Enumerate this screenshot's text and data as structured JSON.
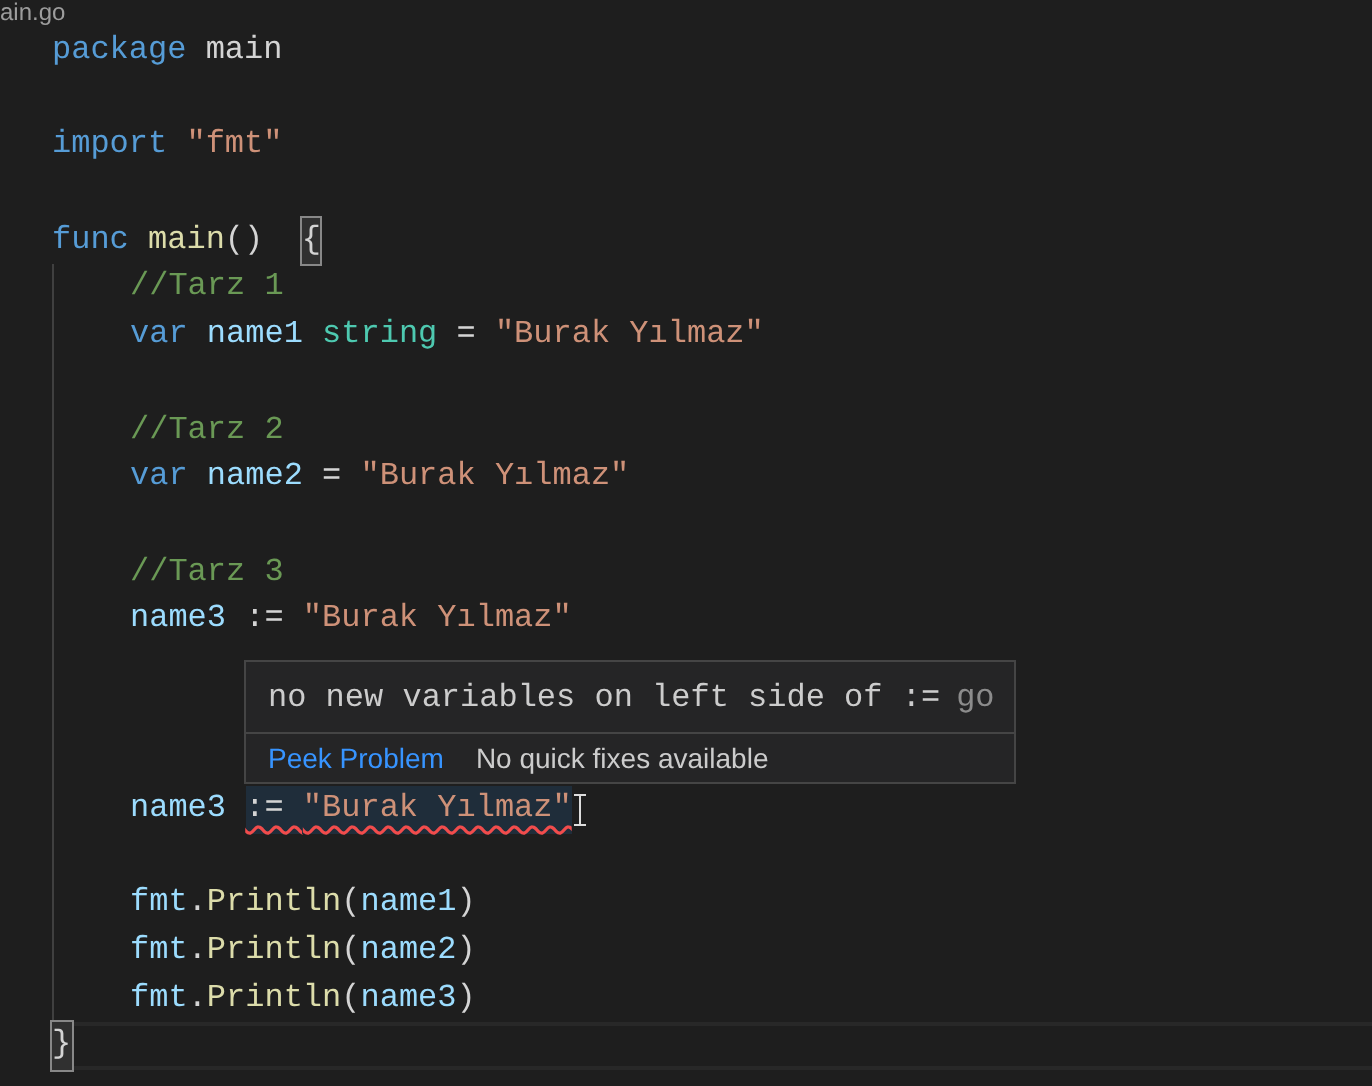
{
  "tab": {
    "title": "ain.go"
  },
  "lines": [
    {
      "kind": "code",
      "tokens": [
        {
          "kind": "keyword",
          "text": "package"
        },
        {
          "kind": "plain",
          "text": " main"
        }
      ]
    },
    {
      "kind": "blank"
    },
    {
      "kind": "code",
      "tokens": [
        {
          "kind": "keyword",
          "text": "import"
        },
        {
          "kind": "string",
          "text": " \"fmt\""
        }
      ]
    },
    {
      "kind": "blank"
    },
    {
      "kind": "code",
      "tokens": [
        {
          "kind": "keyword",
          "text": "func"
        },
        {
          "kind": "function",
          "text": " main"
        },
        {
          "kind": "plain",
          "text": "()  "
        },
        {
          "kind": "bracket",
          "text": "{",
          "matched": true
        }
      ],
      "children": [
        {
          "kind": "code",
          "tokens": [
            {
              "kind": "comment",
              "text": "//Tarz 1"
            }
          ]
        },
        {
          "kind": "code",
          "tokens": [
            {
              "kind": "keyword",
              "text": "var"
            },
            {
              "kind": "variable",
              "text": " name1 "
            },
            {
              "kind": "type",
              "text": "string"
            },
            {
              "kind": "plain",
              "text": " = "
            },
            {
              "kind": "string",
              "text": "\"Burak Yılmaz\""
            }
          ]
        },
        {
          "kind": "blank"
        },
        {
          "kind": "code",
          "tokens": [
            {
              "kind": "comment",
              "text": "//Tarz 2"
            }
          ]
        },
        {
          "kind": "code",
          "tokens": [
            {
              "kind": "keyword",
              "text": "var"
            },
            {
              "kind": "variable",
              "text": " name2"
            },
            {
              "kind": "plain",
              "text": " = "
            },
            {
              "kind": "string",
              "text": "\"Burak Yılmaz\""
            }
          ]
        },
        {
          "kind": "blank"
        },
        {
          "kind": "code",
          "tokens": [
            {
              "kind": "comment",
              "text": "//Tarz 3"
            }
          ]
        },
        {
          "kind": "code",
          "tokens": [
            {
              "kind": "variable",
              "text": "name3"
            },
            {
              "kind": "plain",
              "text": " := "
            },
            {
              "kind": "string",
              "text": "\"Burak Yılmaz\""
            }
          ]
        },
        {
          "kind": "blank"
        },
        {
          "kind": "blank"
        },
        {
          "kind": "blank"
        },
        {
          "kind": "code",
          "pointer": true,
          "tokens": [
            {
              "kind": "variable",
              "text": "name3 "
            },
            {
              "kind": "plain",
              "text": ":= ",
              "error": true
            },
            {
              "kind": "string",
              "text": "\"Burak Yılmaz\"",
              "error": true
            }
          ]
        },
        {
          "kind": "blank"
        },
        {
          "kind": "code",
          "tokens": [
            {
              "kind": "variable",
              "text": "fmt"
            },
            {
              "kind": "plain",
              "text": "."
            },
            {
              "kind": "function",
              "text": "Println"
            },
            {
              "kind": "plain",
              "text": "("
            },
            {
              "kind": "variable",
              "text": "name1"
            },
            {
              "kind": "plain",
              "text": ")"
            }
          ]
        },
        {
          "kind": "code",
          "tokens": [
            {
              "kind": "variable",
              "text": "fmt"
            },
            {
              "kind": "plain",
              "text": "."
            },
            {
              "kind": "function",
              "text": "Println"
            },
            {
              "kind": "plain",
              "text": "("
            },
            {
              "kind": "variable",
              "text": "name2"
            },
            {
              "kind": "plain",
              "text": ")"
            }
          ]
        },
        {
          "kind": "code",
          "tokens": [
            {
              "kind": "variable",
              "text": "fmt"
            },
            {
              "kind": "plain",
              "text": "."
            },
            {
              "kind": "function",
              "text": "Println"
            },
            {
              "kind": "plain",
              "text": "("
            },
            {
              "kind": "variable",
              "text": "name3"
            },
            {
              "kind": "plain",
              "text": ")"
            }
          ]
        }
      ]
    },
    {
      "kind": "code",
      "current": true,
      "tokens": [
        {
          "kind": "bracket",
          "text": "}",
          "matched": true
        }
      ]
    }
  ],
  "hover": {
    "message": "no new variables on left side of :=",
    "source": "go",
    "action": "Peek Problem",
    "status": "No quick fixes available"
  }
}
